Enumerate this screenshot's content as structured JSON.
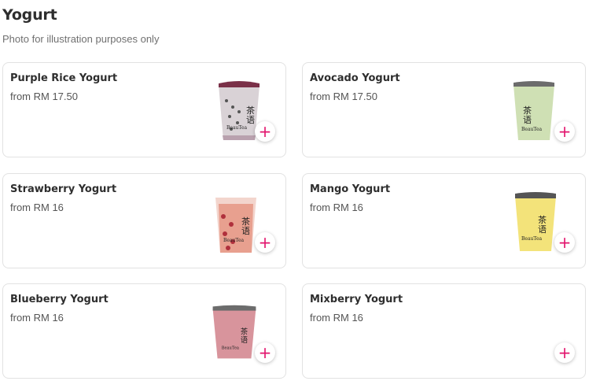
{
  "section": {
    "title": "Yogurt",
    "subtitle": "Photo for illustration purposes only"
  },
  "accent_color": "#e2156d",
  "add_icon": "plus-icon",
  "items": [
    {
      "name": "Purple Rice Yogurt",
      "price": "from RM 17.50",
      "image": "purple-rice-yogurt-cup",
      "cup_color": "#d9d2d6"
    },
    {
      "name": "Avocado Yogurt",
      "price": "from RM 17.50",
      "image": "avocado-yogurt-cup",
      "cup_color": "#cfe0b4"
    },
    {
      "name": "Strawberry Yogurt",
      "price": "from RM 16",
      "image": "strawberry-yogurt-cup",
      "cup_color": "#e8a08f"
    },
    {
      "name": "Mango Yogurt",
      "price": "from RM 16",
      "image": "mango-yogurt-cup",
      "cup_color": "#f3e37a"
    },
    {
      "name": "Blueberry Yogurt",
      "price": "from RM 16",
      "image": "blueberry-yogurt-cup",
      "cup_color": "#d8949c"
    },
    {
      "name": "Mixberry Yogurt",
      "price": "from RM 16",
      "image": null
    }
  ]
}
